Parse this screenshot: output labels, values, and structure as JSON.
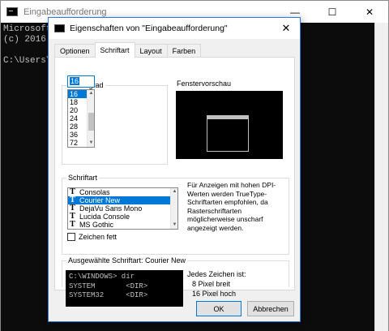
{
  "console": {
    "title": "Eingabeaufforderung",
    "controls": [
      "—",
      "☐",
      "✕"
    ],
    "lines": [
      "Microsoft",
      "(c) 2016",
      "",
      "C:\\Users\\"
    ]
  },
  "dialog": {
    "title": "Eigenschaften von \"Eingabeaufforderung\"",
    "close": "✕",
    "tabs": [
      "Optionen",
      "Schriftart",
      "Layout",
      "Farben"
    ],
    "active_tab": "Schriftart",
    "size_group": {
      "label": "Schriftgrad",
      "value": "16",
      "options": [
        "16",
        "18",
        "20",
        "24",
        "28",
        "36",
        "72"
      ],
      "selected": "16"
    },
    "preview_label": "Fenstervorschau",
    "font_group": {
      "label": "Schriftart",
      "fonts": [
        "Consolas",
        "Courier New",
        "DejaVu Sans Mono",
        "Lucida Console",
        "MS Gothic"
      ],
      "selected": "Courier New",
      "bold_label": "Zeichen fett",
      "bold_checked": false,
      "info": "Für Anzeigen mit hohen DPI-Werten werden TrueType-Schriftarten empfohlen, da Rasterschriftarten möglicherweise unscharf angezeigt werden."
    },
    "selected_font": {
      "label": "Ausgewählte Schriftart: Courier New",
      "sample": "C:\\WINDOWS> dir\nSYSTEM       <DIR>\nSYSTEM32     <DIR>",
      "char_heading": "Jedes Zeichen ist:",
      "width_text": "8 Pixel breit",
      "height_text": "16 Pixel hoch"
    },
    "buttons": {
      "ok": "OK",
      "cancel": "Abbrechen"
    }
  }
}
